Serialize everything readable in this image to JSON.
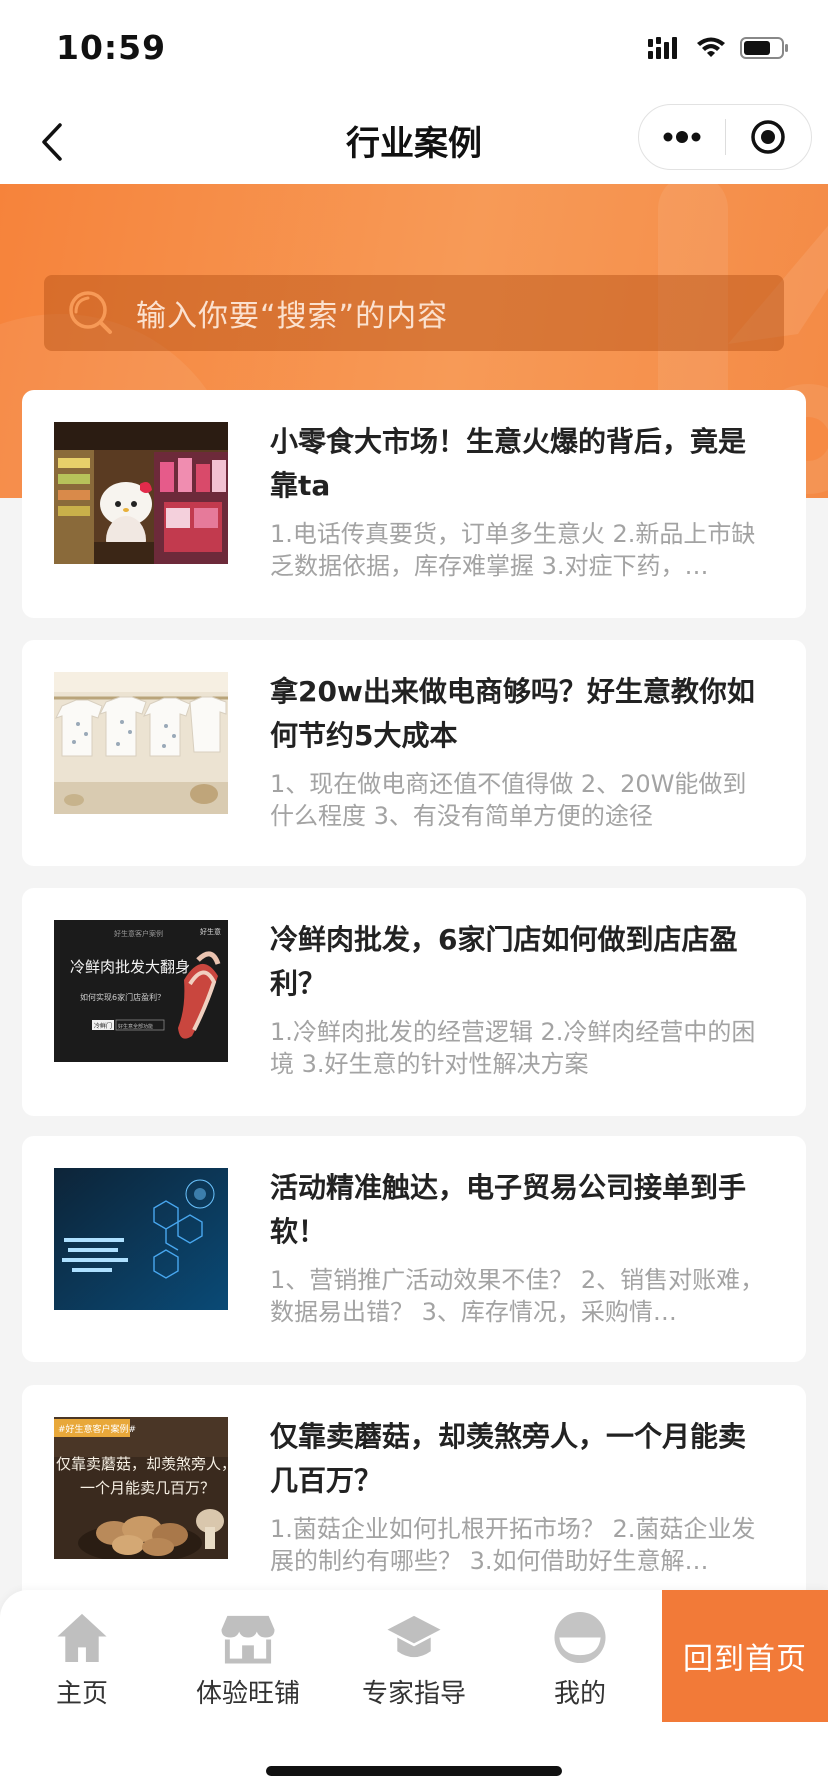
{
  "status_bar": {
    "time": "10:59"
  },
  "nav": {
    "title": "行业案例",
    "back_icon": "chevron-left-icon",
    "more_icon": "more-dots-icon",
    "target_icon": "target-icon"
  },
  "search": {
    "placeholder": "输入你要“搜索”的内容"
  },
  "cases": [
    {
      "title": "小零食大市场！生意火爆的背后，竟是靠ta",
      "desc": "1.电话传真要货，订单多生意火 2.新品上市缺乏数据依据，库存难掌握 3.对症下药，…",
      "thumb": "snack-store-photo"
    },
    {
      "title": "拿20w出来做电商够吗？好生意教你如何节约5大成本",
      "desc": "1、现在做电商还值不值得做 2、20W能做到什么程度 3、有没有简单方便的途径",
      "thumb": "baby-clothes-photo"
    },
    {
      "title": "冷鲜肉批发，6家门店如何做到店店盈利？",
      "desc": "1.冷鲜肉批发的经营逻辑 2.冷鲜肉经营中的困境 3.好生意的针对性解决方案",
      "thumb": "meat-poster",
      "thumb_text": {
        "badge": "好生意客户案例",
        "brand": "好生意",
        "headline": "冷鲜肉批发大翻身",
        "sub": "如何实现6家门店盈利？",
        "tag1": "冷鲜门",
        "tag2": "好生意全部功能"
      }
    },
    {
      "title": "活动精准触达，电子贸易公司接单到手软！",
      "desc": "1、营销推广活动效果不佳？ 2、销售对账难，数据易出错？ 3、库存情况，采购情…",
      "thumb": "molecule-tech-photo"
    },
    {
      "title": "仅靠卖蘑菇，却羡煞旁人，一个月能卖几百万？",
      "desc": "1.菌菇企业如何扎根开拓市场？ 2.菌菇企业发展的制约有哪些？ 3.如何借助好生意解…",
      "thumb": "mushroom-poster",
      "thumb_text": {
        "badge": "#好生意客户案例#",
        "line1": "仅靠卖蘑菇，却羡煞旁人，",
        "line2": "一个月能卖几百万？"
      }
    }
  ],
  "tabs": [
    {
      "label": "主页",
      "icon": "home-icon"
    },
    {
      "label": "体验旺铺",
      "icon": "store-icon"
    },
    {
      "label": "专家指导",
      "icon": "graduation-cap-icon"
    },
    {
      "label": "我的",
      "icon": "user-avatar-icon"
    }
  ],
  "home_button": {
    "label": "回到首页"
  },
  "colors": {
    "accent": "#f27a38",
    "banner": "#f6833b",
    "text": "#222222",
    "subtext": "#a3a3a3"
  }
}
